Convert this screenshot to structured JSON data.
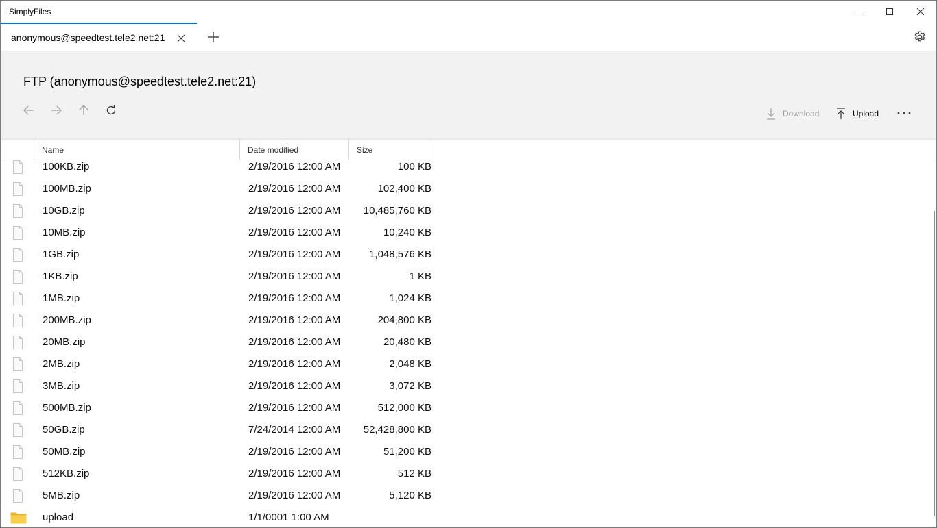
{
  "app": {
    "title": "SimplyFiles"
  },
  "window_controls": {
    "minimize_icon": "minimize-icon",
    "maximize_icon": "maximize-icon",
    "close_icon": "close-icon"
  },
  "tabs": [
    {
      "label": "anonymous@speedtest.tele2.net:21",
      "active": true
    }
  ],
  "header": {
    "title": "FTP (anonymous@speedtest.tele2.net:21)"
  },
  "toolbar": {
    "download_label": "Download",
    "upload_label": "Upload",
    "more_label": "···"
  },
  "columns": {
    "name": "Name",
    "date": "Date modified",
    "size": "Size"
  },
  "files": [
    {
      "name": "100KB.zip",
      "date": "2/19/2016 12:00 AM",
      "size": "100 KB",
      "type": "file"
    },
    {
      "name": "100MB.zip",
      "date": "2/19/2016 12:00 AM",
      "size": "102,400 KB",
      "type": "file"
    },
    {
      "name": "10GB.zip",
      "date": "2/19/2016 12:00 AM",
      "size": "10,485,760 KB",
      "type": "file"
    },
    {
      "name": "10MB.zip",
      "date": "2/19/2016 12:00 AM",
      "size": "10,240 KB",
      "type": "file"
    },
    {
      "name": "1GB.zip",
      "date": "2/19/2016 12:00 AM",
      "size": "1,048,576 KB",
      "type": "file"
    },
    {
      "name": "1KB.zip",
      "date": "2/19/2016 12:00 AM",
      "size": "1 KB",
      "type": "file"
    },
    {
      "name": "1MB.zip",
      "date": "2/19/2016 12:00 AM",
      "size": "1,024 KB",
      "type": "file"
    },
    {
      "name": "200MB.zip",
      "date": "2/19/2016 12:00 AM",
      "size": "204,800 KB",
      "type": "file"
    },
    {
      "name": "20MB.zip",
      "date": "2/19/2016 12:00 AM",
      "size": "20,480 KB",
      "type": "file"
    },
    {
      "name": "2MB.zip",
      "date": "2/19/2016 12:00 AM",
      "size": "2,048 KB",
      "type": "file"
    },
    {
      "name": "3MB.zip",
      "date": "2/19/2016 12:00 AM",
      "size": "3,072 KB",
      "type": "file"
    },
    {
      "name": "500MB.zip",
      "date": "2/19/2016 12:00 AM",
      "size": "512,000 KB",
      "type": "file"
    },
    {
      "name": "50GB.zip",
      "date": "7/24/2014 12:00 AM",
      "size": "52,428,800 KB",
      "type": "file"
    },
    {
      "name": "50MB.zip",
      "date": "2/19/2016 12:00 AM",
      "size": "51,200 KB",
      "type": "file"
    },
    {
      "name": "512KB.zip",
      "date": "2/19/2016 12:00 AM",
      "size": "512 KB",
      "type": "file"
    },
    {
      "name": "5MB.zip",
      "date": "2/19/2016 12:00 AM",
      "size": "5,120 KB",
      "type": "file"
    },
    {
      "name": "upload",
      "date": "1/1/0001 1:00 AM",
      "size": "",
      "type": "folder"
    }
  ],
  "colors": {
    "accent": "#0078d7",
    "header_bg": "#f2f2f2",
    "folder": "#f2c744",
    "disabled": "#a0a0a0"
  }
}
